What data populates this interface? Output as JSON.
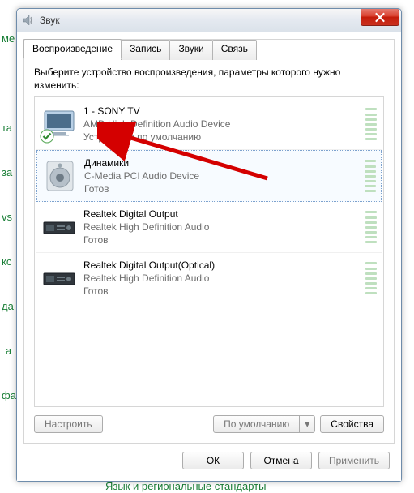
{
  "window": {
    "title": "Звук"
  },
  "tabs": {
    "playback": "Воспроизведение",
    "record": "Запись",
    "sounds": "Звуки",
    "comm": "Связь"
  },
  "instruction": "Выберите устройство воспроизведения, параметры которого нужно изменить:",
  "devices": [
    {
      "name": "1 - SONY TV",
      "sub": "AMD High Definition Audio Device",
      "status": "Устройство по умолчанию",
      "default": true,
      "selected": false,
      "icon": "tv"
    },
    {
      "name": "Динамики",
      "sub": "C-Media PCI Audio Device",
      "status": "Готов",
      "default": false,
      "selected": true,
      "icon": "speaker"
    },
    {
      "name": "Realtek Digital Output",
      "sub": "Realtek High Definition Audio",
      "status": "Готов",
      "default": false,
      "selected": false,
      "icon": "receiver"
    },
    {
      "name": "Realtek Digital Output(Optical)",
      "sub": "Realtek High Definition Audio",
      "status": "Готов",
      "default": false,
      "selected": false,
      "icon": "receiver"
    }
  ],
  "buttons": {
    "configure": "Настроить",
    "default": "По умолчанию",
    "properties": "Свойства",
    "ok": "ОК",
    "cancel": "Отмена",
    "apply": "Применить"
  },
  "bg_labels": {
    "a": "ме",
    "b": "та",
    "c": "за",
    "d": "vs",
    "e": "кс",
    "f": "да",
    "g": "а",
    "h": "фа",
    "i": "Язык и региональные стандарты"
  }
}
